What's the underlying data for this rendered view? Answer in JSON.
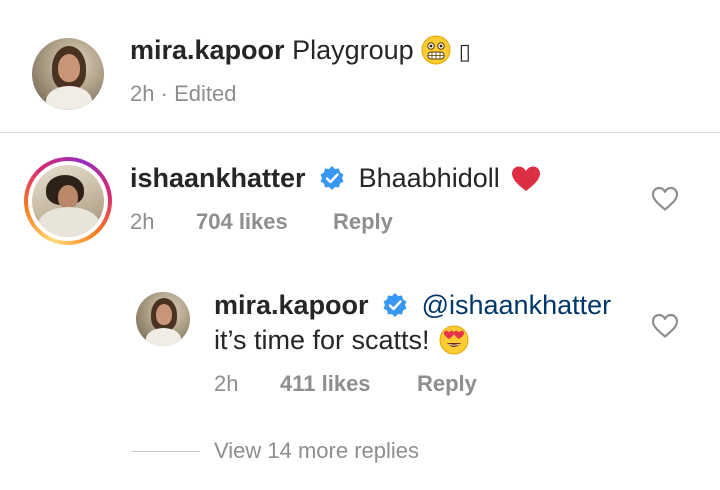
{
  "caption": {
    "username": "mira.kapoor",
    "text": "Playgroup",
    "emoji_1": "grimacing-face",
    "trailing_glyph": "▯",
    "time": "2h",
    "separator": "·",
    "edited": "Edited"
  },
  "comment": {
    "username": "ishaankhatter",
    "verified": true,
    "text": "Bhaabhidoll",
    "emoji": "red-heart",
    "time": "2h",
    "likes": "704 likes",
    "reply_label": "Reply"
  },
  "reply": {
    "username": "mira.kapoor",
    "verified": true,
    "mention": "@ishaankhatter",
    "text": "it’s time for scatts!",
    "emoji": "heart-eyes-face",
    "time": "2h",
    "likes": "411 likes",
    "reply_label": "Reply"
  },
  "view_more_replies": "View 14 more replies",
  "colors": {
    "text": "#262626",
    "secondary": "#8e8e8e",
    "mention": "#00376b",
    "verified_blue": "#3897f0",
    "heart_red": "#ed4956",
    "divider": "#dbdbdb"
  }
}
